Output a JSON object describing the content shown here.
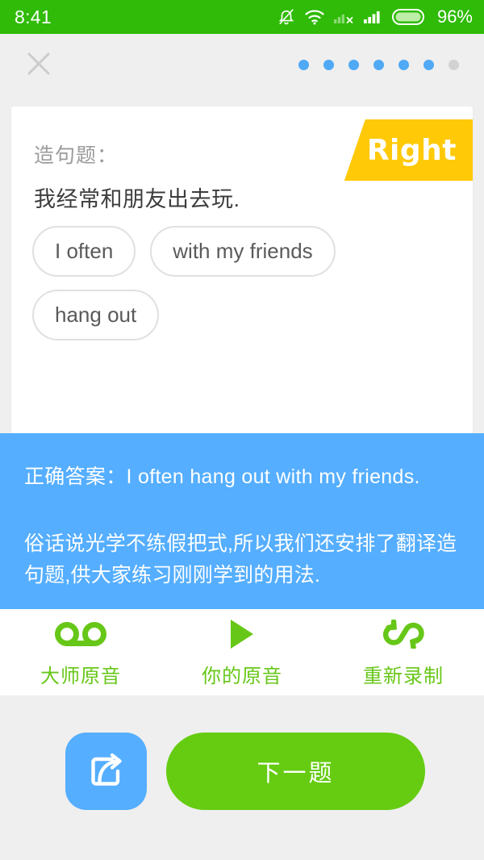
{
  "status_bar": {
    "time": "8:41",
    "battery_percent": "96%",
    "icons": [
      "notifications-off-icon",
      "wifi-icon",
      "sim-no-signal-icon",
      "cellular-signal-icon",
      "battery-icon"
    ],
    "background_color": "#2FBB07"
  },
  "topnav": {
    "close_label": "×",
    "close_icon": "close-icon",
    "progress_dots": [
      {
        "active": true
      },
      {
        "active": true
      },
      {
        "active": true
      },
      {
        "active": true
      },
      {
        "active": true
      },
      {
        "active": true
      },
      {
        "active": false
      }
    ],
    "active_color": "#4FA9F5",
    "inactive_color": "#D2D2D2"
  },
  "card": {
    "badge": {
      "text": "Right",
      "color": "#FFC907",
      "text_color": "#FFFFFF"
    },
    "question_label": "造句题：",
    "question_text": "我经常和朋友出去玩.",
    "chips": [
      {
        "label": "I often"
      },
      {
        "label": "with my friends"
      },
      {
        "label": "hang out"
      }
    ]
  },
  "answer_panel": {
    "background_color": "#55AEFF",
    "correct_answer": "正确答案：I often hang out with my friends.",
    "note": "俗话说光学不练假把式,所以我们还安排了翻译造句题,供大家练习刚刚学到的用法."
  },
  "audio_actions": {
    "accent_color": "#67C718",
    "items": [
      {
        "icon": "voicemail-icon",
        "label": "大师原音"
      },
      {
        "icon": "play-icon",
        "label": "你的原音"
      },
      {
        "icon": "loop-rerecord-icon",
        "label": "重新录制"
      }
    ]
  },
  "bottom_bar": {
    "share_button": {
      "icon": "share-icon",
      "color": "#55AEFF"
    },
    "next_button": {
      "label": "下一题",
      "color": "#65CC11"
    }
  }
}
